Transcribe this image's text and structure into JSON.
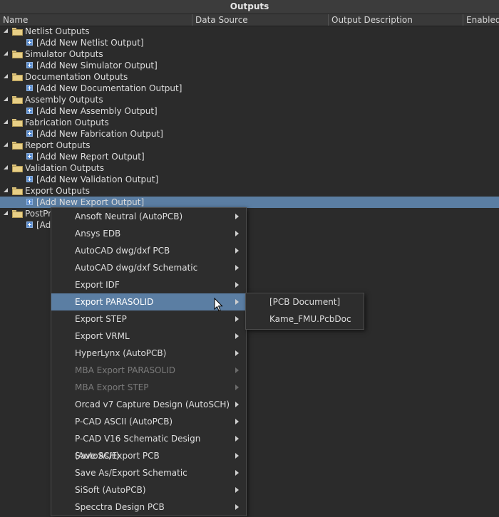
{
  "panel": {
    "title": "Outputs"
  },
  "columns": [
    "Name",
    "Data Source",
    "Output Description",
    "Enabled"
  ],
  "tree": [
    {
      "group": "Netlist Outputs",
      "add": "[Add New Netlist Output]"
    },
    {
      "group": "Simulator Outputs",
      "add": "[Add New Simulator Output]"
    },
    {
      "group": "Documentation Outputs",
      "add": "[Add New Documentation Output]"
    },
    {
      "group": "Assembly Outputs",
      "add": "[Add New Assembly Output]"
    },
    {
      "group": "Fabrication Outputs",
      "add": "[Add New Fabrication Output]"
    },
    {
      "group": "Report Outputs",
      "add": "[Add New Report Output]"
    },
    {
      "group": "Validation Outputs",
      "add": "[Add New Validation Output]"
    },
    {
      "group": "Export Outputs",
      "add": "[Add New Export Output]"
    },
    {
      "group": "PostPro",
      "add": "[Add"
    }
  ],
  "context_menu": [
    {
      "label": "Ansoft Neutral (AutoPCB)",
      "disabled": false
    },
    {
      "label": "Ansys EDB",
      "disabled": false
    },
    {
      "label": "AutoCAD dwg/dxf PCB",
      "disabled": false,
      "underline": true
    },
    {
      "label": "AutoCAD dwg/dxf Schematic",
      "disabled": false,
      "underline": true
    },
    {
      "label": "Export IDF",
      "disabled": false,
      "underline": true
    },
    {
      "label": "Export PARASOLID",
      "disabled": false,
      "highlighted": true
    },
    {
      "label": "Export STEP",
      "disabled": false,
      "underline": true
    },
    {
      "label": "Export VRML",
      "disabled": false,
      "underline": true
    },
    {
      "label": "HyperLynx (AutoPCB)",
      "disabled": false,
      "underline": true
    },
    {
      "label": "MBA Export PARASOLID",
      "disabled": true
    },
    {
      "label": "MBA Export STEP",
      "disabled": true,
      "underline": true
    },
    {
      "label": "Orcad v7 Capture Design (AutoSCH)",
      "disabled": false
    },
    {
      "label": "P-CAD ASCII (AutoPCB)",
      "disabled": false
    },
    {
      "label": "P-CAD V16 Schematic Design (AutoSCH)",
      "disabled": false
    },
    {
      "label": "Save As/Export PCB",
      "disabled": false
    },
    {
      "label": "Save As/Export Schematic",
      "disabled": false
    },
    {
      "label": "SiSoft (AutoPCB)",
      "disabled": false
    },
    {
      "label": "Specctra Design PCB",
      "disabled": false
    }
  ],
  "submenu": [
    "[PCB Document]",
    "Kame_FMU.PcbDoc"
  ],
  "colors": {
    "selection": "#5b7ea3",
    "background": "#2b2b2b",
    "folder": "#e8cf86"
  },
  "icons": {
    "folder": "folder-icon",
    "add": "add-icon",
    "expand": "expand-triangle-icon",
    "submenu": "submenu-arrow-icon",
    "cursor": "mouse-cursor-icon"
  }
}
